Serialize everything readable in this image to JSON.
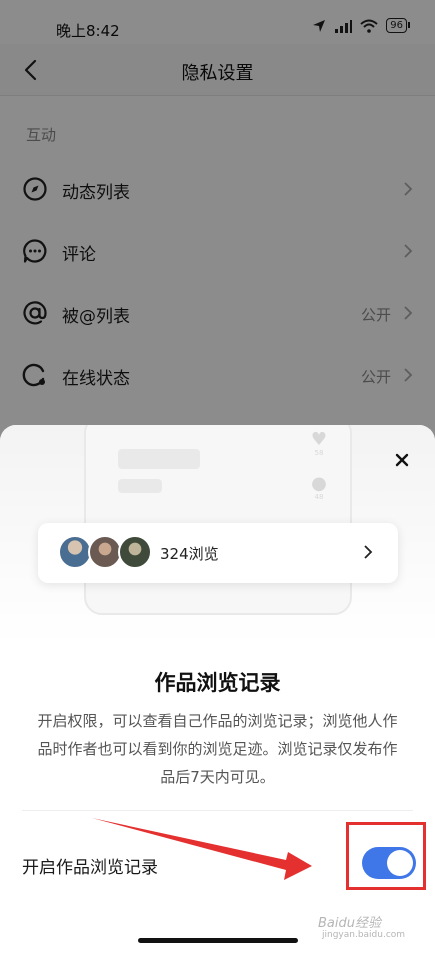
{
  "status_bar": {
    "time": "晚上8:42",
    "battery": "96"
  },
  "nav": {
    "title": "隐私设置"
  },
  "section": {
    "label": "互动"
  },
  "rows": [
    {
      "label": "动态列表",
      "value": ""
    },
    {
      "label": "评论",
      "value": ""
    },
    {
      "label": "被@列表",
      "value": "公开"
    },
    {
      "label": "在线状态",
      "value": "公开"
    }
  ],
  "sheet": {
    "preview_counts": {
      "likes": "58",
      "comments": "48"
    },
    "views_label": "324浏览",
    "title": "作品浏览记录",
    "description": "开启权限，可以查看自己作品的浏览记录；浏览他人作品时作者也可以看到你的浏览足迹。浏览记录仅发布作品后7天内可见。",
    "toggle_label": "开启作品浏览记录",
    "toggle_on": true
  },
  "watermark": {
    "text": "Baidu经验",
    "sub": "jingyan.baidu.com"
  },
  "colors": {
    "accent": "#3f76e8",
    "annotation": "#e53030"
  }
}
